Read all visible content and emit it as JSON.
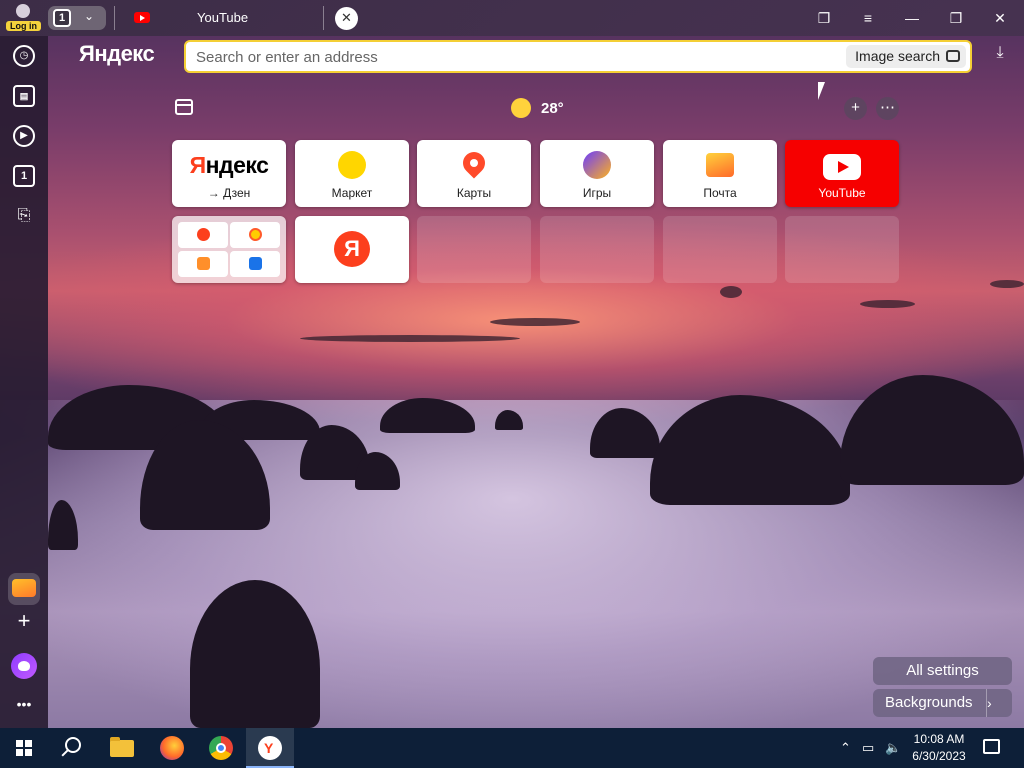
{
  "browser": {
    "login_badge": "Log in",
    "tab_count": "1",
    "active_tab_title": "YouTube",
    "brand": "Яндекс",
    "address_placeholder": "Search or enter an address",
    "image_search_label": "Image search"
  },
  "sidebar": {
    "tab_count": "1"
  },
  "widgets": {
    "temperature": "28°",
    "add_symbol": "+",
    "more_symbol": "⋯"
  },
  "tiles": [
    {
      "label": "→ Дзен",
      "logo": "Яндекс",
      "icon": "yandex-logo"
    },
    {
      "label": "Маркет",
      "icon": "market-icon"
    },
    {
      "label": "Карты",
      "icon": "map-pin-icon"
    },
    {
      "label": "Игры",
      "icon": "games-icon"
    },
    {
      "label": "Почта",
      "icon": "mail-icon"
    },
    {
      "label": "YouTube",
      "icon": "youtube-icon",
      "color": "#f60000"
    }
  ],
  "tiles_row2": {
    "folder_icons": [
      "yandex-icon",
      "alice-icon",
      "mail-icon",
      "link-icon"
    ],
    "yandex_letter": "Я"
  },
  "bottom": {
    "all_settings": "All settings",
    "backgrounds": "Backgrounds",
    "backgrounds_arrow": "›"
  },
  "taskbar": {
    "time": "10:08 AM",
    "date": "6/30/2023",
    "apps": [
      "start",
      "search",
      "file-explorer",
      "firefox",
      "chrome",
      "yandex-browser"
    ]
  },
  "colors": {
    "accent_yellow": "#f4cf35",
    "youtube_red": "#f60000",
    "yandex_red": "#fc3f1d",
    "taskbar": "#0d1f38"
  }
}
